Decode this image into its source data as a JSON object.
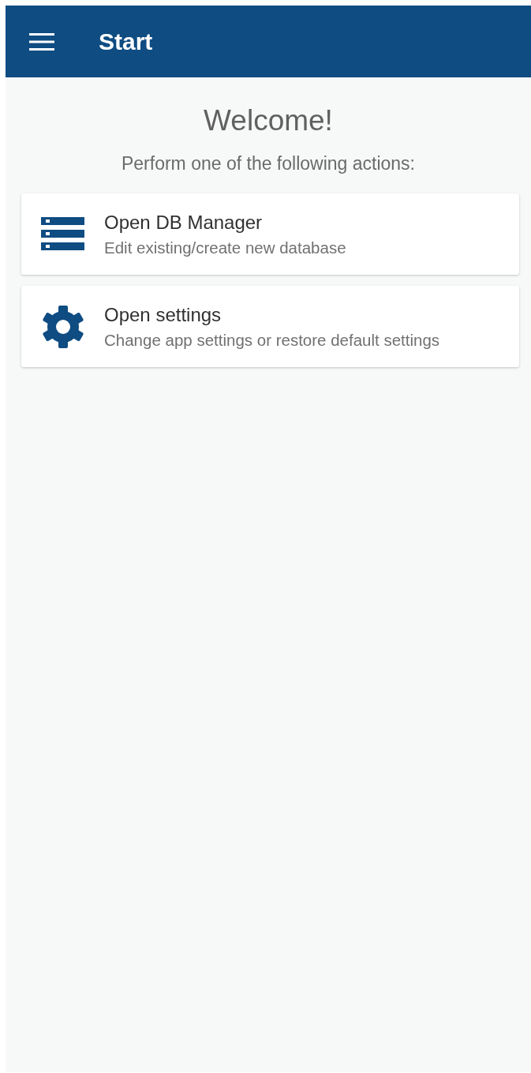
{
  "app_bar": {
    "title": "Start"
  },
  "heading": "Welcome!",
  "subtitle": "Perform one of the following actions:",
  "actions": [
    {
      "kind": "database",
      "title": "Open DB Manager",
      "description": "Edit existing/create new database"
    },
    {
      "kind": "settings",
      "title": "Open settings",
      "description": "Change app settings or restore default settings"
    }
  ]
}
